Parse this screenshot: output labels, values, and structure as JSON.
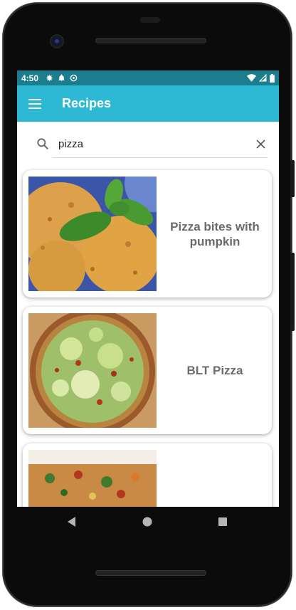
{
  "status_bar": {
    "time": "4:50",
    "left_icons": [
      "settings-icon",
      "notification-bell-icon",
      "sync-icon"
    ],
    "right_icons": [
      "wifi-icon",
      "cell-signal-icon",
      "battery-icon"
    ],
    "color": "#1c7d8f"
  },
  "app_bar": {
    "title": "Recipes",
    "menu_icon": "hamburger-menu-icon",
    "color": "#2db9d4"
  },
  "search": {
    "value": "pizza",
    "placeholder": "",
    "search_icon": "search-icon",
    "clear_icon": "close-icon"
  },
  "recipes": [
    {
      "title": "Pizza bites with pumpkin",
      "image": "pizza-bites-photo"
    },
    {
      "title": "BLT Pizza",
      "image": "blt-pizza-photo"
    },
    {
      "title": "",
      "image": "pizza-slices-photo"
    }
  ],
  "navigation": {
    "back_icon": "back-triangle-icon",
    "home_icon": "home-circle-icon",
    "recents_icon": "recents-square-icon"
  }
}
